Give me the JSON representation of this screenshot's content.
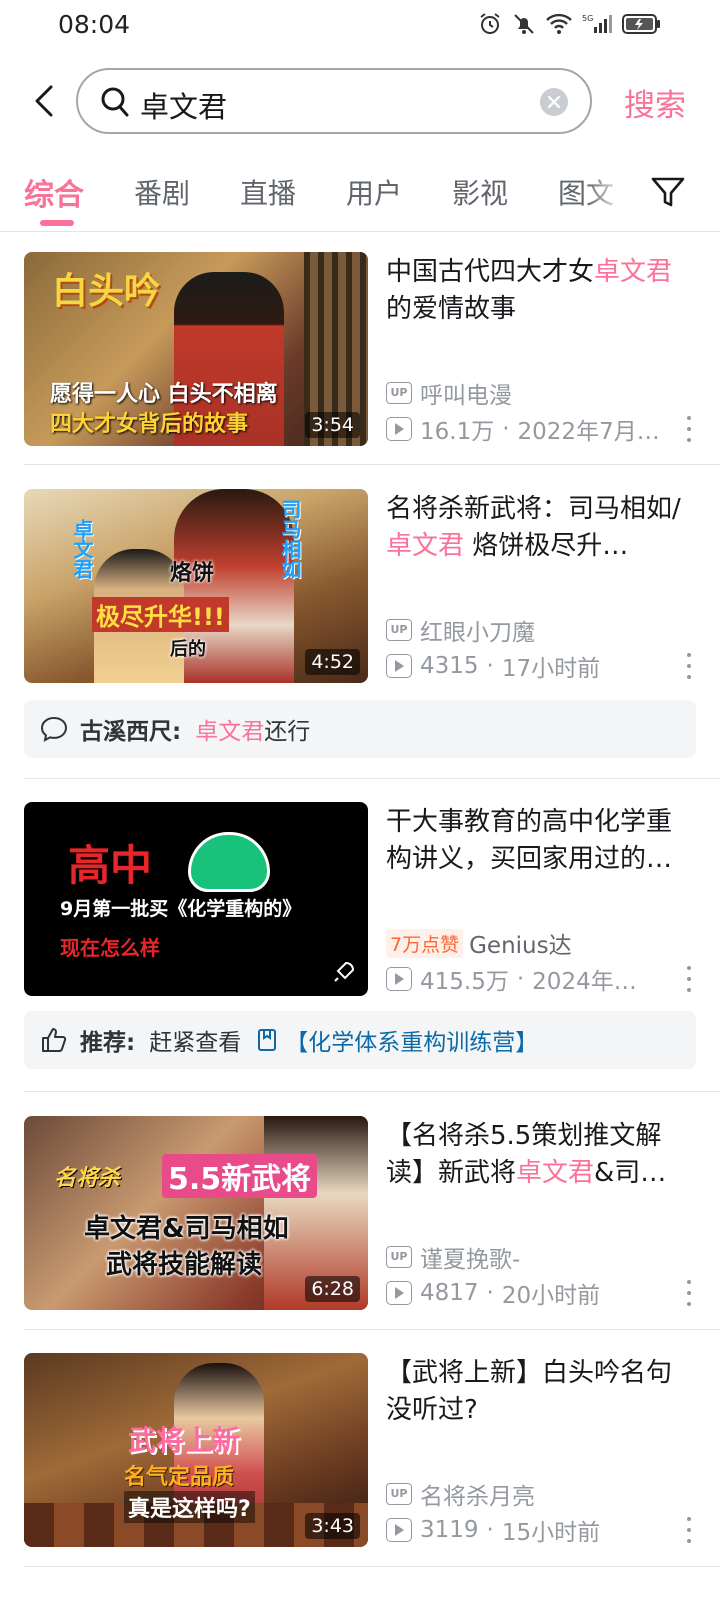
{
  "status_bar": {
    "time": "08:04"
  },
  "search": {
    "query": "卓文君",
    "button_label": "搜索"
  },
  "tabs": [
    {
      "label": "综合",
      "active": true
    },
    {
      "label": "番剧"
    },
    {
      "label": "直播"
    },
    {
      "label": "用户"
    },
    {
      "label": "影视"
    },
    {
      "label": "图文"
    }
  ],
  "results": [
    {
      "title_before": "中国古代四大才女",
      "title_highlight": "卓文君",
      "title_after": "的爱情故事",
      "thumb_line1": "白头吟",
      "thumb_line2": "愿得一人心 白头不相离",
      "thumb_line3": "四大才女背后的故事",
      "duration": "3:54",
      "uploader": "呼叫电漫",
      "views": "16.1万",
      "date": "2022年7月…"
    },
    {
      "title_before": "名将杀新武将：司马相如/",
      "title_highlight": "卓文君",
      "title_after": " 烙饼极尽升…",
      "thumb_line1": "卓文君",
      "thumb_line2": "司马相如",
      "thumb_line3": "烙饼",
      "thumb_line4": "极尽升华!!!",
      "thumb_line5": "后的",
      "duration": "4:52",
      "uploader": "红眼小刀魔",
      "views": "4315",
      "date": "17小时前",
      "comment": {
        "name": "古溪西尺:",
        "highlight": "卓文君",
        "text": "还行"
      }
    },
    {
      "title": "干大事教育的高中化学重构讲义，买回家用过的…",
      "thumb_line1": "高中",
      "thumb_line2": "9月第一批买《化学重构的》",
      "thumb_line3": "现在怎么样",
      "like_badge": "7万点赞",
      "uploader": "Genius达",
      "views": "415.5万",
      "date": "2024年…",
      "recommend": {
        "label": "推荐:",
        "text": "赶紧查看",
        "link": "【化学体系重构训练营】"
      }
    },
    {
      "title_before": "【名将杀5.5策划推文解读】新武将",
      "title_highlight": "卓文君",
      "title_after": "&司…",
      "thumb_line1": "名将杀",
      "thumb_line2": "5.5新武将",
      "thumb_line3": "卓文君&司马相如",
      "thumb_line4": "武将技能解读",
      "duration": "6:28",
      "uploader": "谨夏挽歌-",
      "views": "4817",
      "date": "20小时前"
    },
    {
      "title": "【武将上新】白头吟名句没听过?",
      "thumb_line1": "武将上新",
      "thumb_line2": "名气定品质",
      "thumb_line3": "真是这样吗?",
      "duration": "3:43",
      "uploader": "名将杀月亮",
      "views": "3119",
      "date": "15小时前"
    }
  ],
  "colors": {
    "accent": "#fb7299",
    "muted": "#9499a0",
    "link": "#0d6aa8"
  }
}
